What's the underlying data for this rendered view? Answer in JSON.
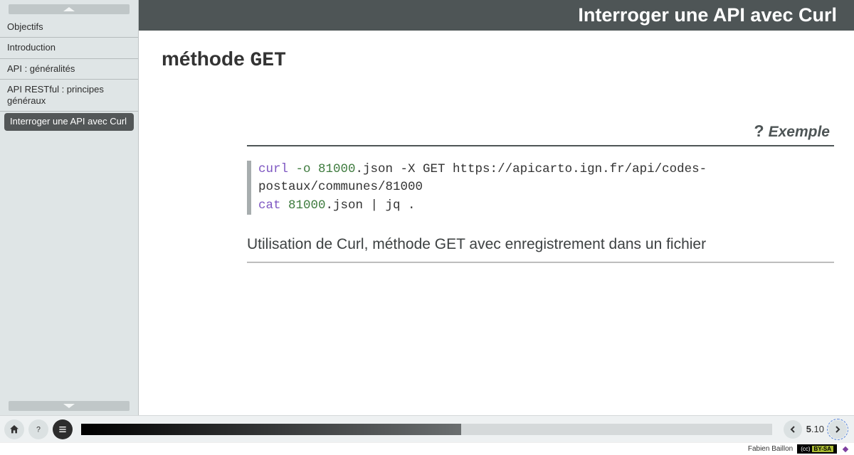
{
  "sidebar": {
    "items": [
      {
        "label": "Objectifs"
      },
      {
        "label": "Introduction"
      },
      {
        "label": "API : généralités"
      },
      {
        "label": "API RESTful : principes généraux"
      },
      {
        "label": "Interroger une API avec Curl"
      }
    ],
    "active_index": 4
  },
  "titlebar": {
    "title": "Interroger une API avec Curl"
  },
  "content": {
    "heading_prefix": "méthode ",
    "heading_mono": "GET",
    "example_label": "Exemple",
    "code_lines": [
      {
        "cmd": "curl",
        "opts": " -o 81000",
        "plain1": ".json -X GET https://apicarto.ign.fr/api/codes-postaux/communes/81000"
      },
      {
        "cmd": "cat",
        "opts": " 81000",
        "plain1": ".json | jq ."
      }
    ],
    "caption": "Utilisation de Curl, méthode GET avec enregistrement dans un fichier"
  },
  "footer": {
    "page_current": "5",
    "page_sub": ".10",
    "progress_percent": 55
  },
  "subfooter": {
    "author": "Fabien Baillon",
    "license": "BY-SA"
  }
}
